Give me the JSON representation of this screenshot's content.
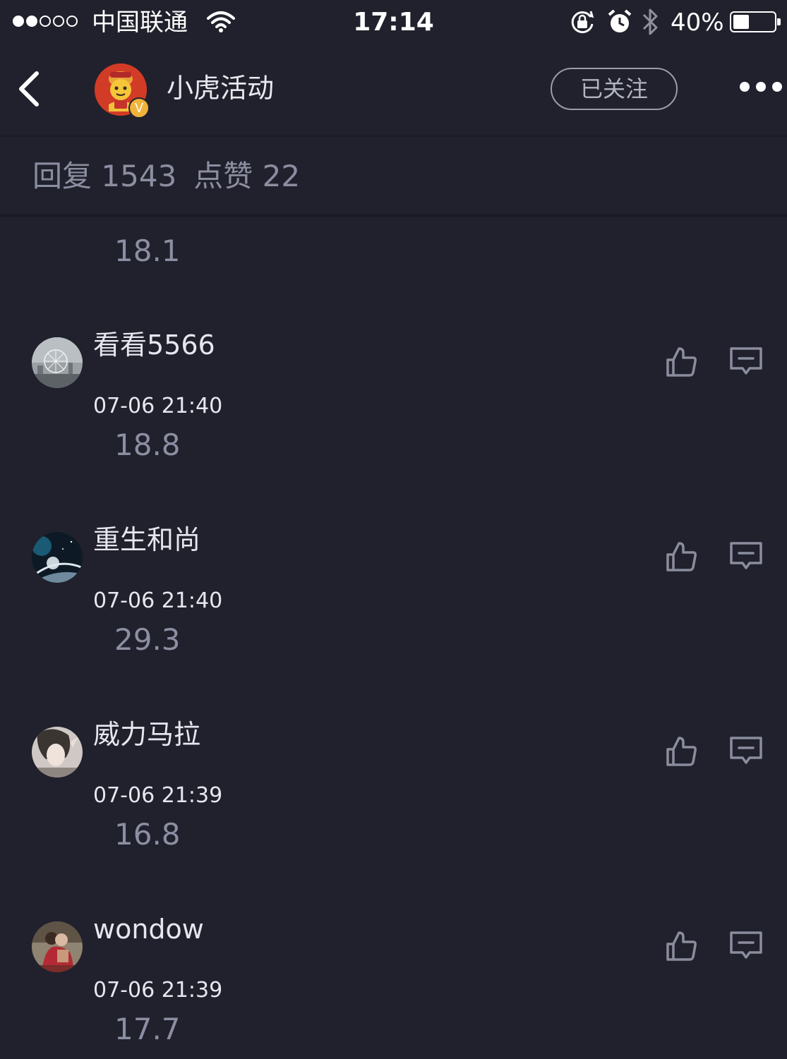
{
  "status_bar": {
    "carrier": "中国联通",
    "time": "17:14",
    "battery_percent": "40%",
    "battery_level": 0.4,
    "signal_bars_filled": 2,
    "signal_bars_total": 5,
    "icons": [
      "signal-dots-icon",
      "wifi-icon",
      "rotation-lock-icon",
      "alarm-icon",
      "bluetooth-icon",
      "battery-icon"
    ]
  },
  "header": {
    "back_icon": "chevron-left-icon",
    "title": "小虎活动",
    "verified_badge": "V",
    "follow_label": "已关注",
    "more_icon": "more-dots-icon"
  },
  "stats": {
    "replies_label": "回复",
    "replies_count": "1543",
    "likes_label": "点赞",
    "likes_count": "22"
  },
  "partial_comment": {
    "text": "18.1"
  },
  "comments": [
    {
      "name": "看看5566",
      "time": "07-06 21:40",
      "text": "18.8",
      "avatar": "ferris-wheel"
    },
    {
      "name": "重生和尚",
      "time": "07-06 21:40",
      "text": "29.3",
      "avatar": "planet"
    },
    {
      "name": "威力马拉",
      "time": "07-06 21:39",
      "text": "16.8",
      "avatar": "portrait"
    },
    {
      "name": "wondow",
      "time": "07-06 21:39",
      "text": "17.7",
      "avatar": "couple"
    }
  ],
  "actions": {
    "like_icon": "thumbs-up-icon",
    "reply_icon": "comment-icon"
  },
  "colors": {
    "background": "#20212c",
    "divider": "#191a22",
    "primary_text": "#e6e7ee",
    "secondary_text": "#8c8fa3",
    "icon_gray": "#8a8d9e"
  }
}
